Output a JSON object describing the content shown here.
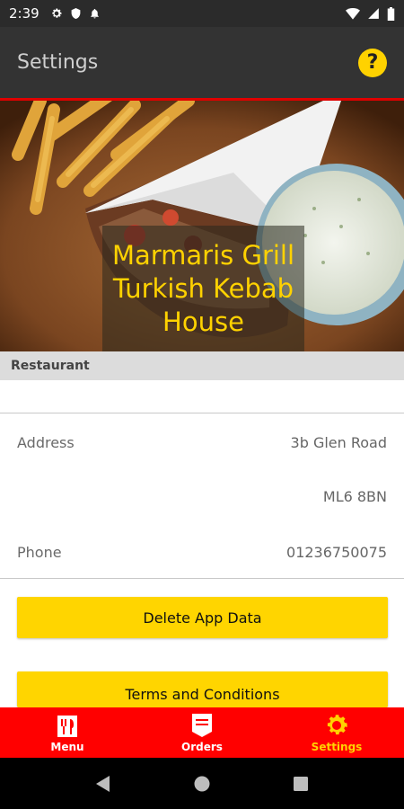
{
  "status_bar": {
    "time": "2:39",
    "left_icons": [
      "gear-icon",
      "shield-icon",
      "bell-icon"
    ],
    "right_icons": [
      "wifi-icon",
      "signal-icon",
      "battery-icon"
    ]
  },
  "app_bar": {
    "title": "Settings",
    "help_icon": "help-icon",
    "help_glyph": "?"
  },
  "hero": {
    "restaurant_name": "Marmaris Grill Turkish Kebab House"
  },
  "section": {
    "header": "Restaurant"
  },
  "details": {
    "address_label": "Address",
    "address_line1": "3b Glen Road",
    "address_line2": "ML6 8BN",
    "phone_label": "Phone",
    "phone_value": "01236750075"
  },
  "actions": {
    "delete_label": "Delete App Data",
    "terms_label": "Terms and Conditions"
  },
  "bottom_nav": {
    "items": [
      {
        "label": "Menu",
        "icon": "menu-icon"
      },
      {
        "label": "Orders",
        "icon": "orders-icon"
      },
      {
        "label": "Settings",
        "icon": "settings-icon",
        "active": true
      }
    ]
  },
  "colors": {
    "accent_yellow": "#ffd200",
    "nav_red": "#ff0000",
    "app_bar": "#333333"
  }
}
